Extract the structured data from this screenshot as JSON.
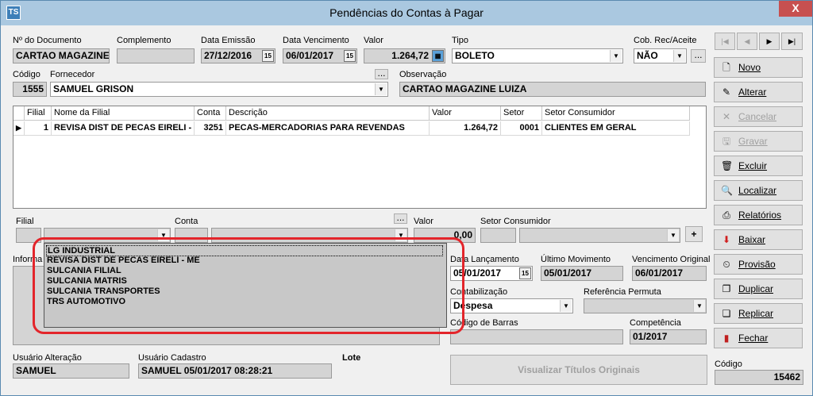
{
  "window": {
    "title": "Pendências do Contas à Pagar",
    "app_icon": "TS",
    "close": "X"
  },
  "fields": {
    "doc_label": "Nº do Documento",
    "doc_value": "CARTAO MAGAZINE",
    "complemento_label": "Complemento",
    "complemento_value": "",
    "emissao_label": "Data Emissão",
    "emissao_value": "27/12/2016",
    "vencimento_label": "Data Vencimento",
    "vencimento_value": "06/01/2017",
    "valor_label": "Valor",
    "valor_value": "1.264,72",
    "tipo_label": "Tipo",
    "tipo_value": "BOLETO",
    "cob_label": "Cob. Rec/Aceite",
    "cob_value": "NÃO",
    "codigo_label": "Código",
    "codigo_value": "1555",
    "fornecedor_label": "Fornecedor",
    "fornecedor_value": "SAMUEL GRISON",
    "observacao_label": "Observação",
    "observacao_value": "CARTAO MAGAZINE LUIZA",
    "ellipsis": "..."
  },
  "grid": {
    "headers": [
      "Filial",
      "Nome da Filial",
      "Conta",
      "Descrição",
      "Valor",
      "Setor",
      "Setor Consumidor"
    ],
    "rows": [
      [
        "1",
        "REVISA DIST DE PECAS EIRELI - M",
        "3251",
        "PECAS-MERCADORIAS PARA REVENDAS",
        "1.264,72",
        "0001",
        "CLIENTES EM GERAL"
      ]
    ]
  },
  "entry": {
    "filial_label": "Filial",
    "conta_label": "Conta",
    "valor_label": "Valor",
    "valor_value": "0,00",
    "setor_label": "Setor Consumidor",
    "add": "+"
  },
  "popup": {
    "items": [
      "LG INDUSTRIAL",
      "REVISA DIST DE PECAS EIRELI - ME",
      "SULCANIA FILIAL",
      "SULCANIA MATRIS",
      "SULCANIA TRANSPORTES",
      "TRS AUTOMOTIVO"
    ]
  },
  "info": {
    "label": "Informa"
  },
  "dates": {
    "lancamento_label": "Data Lançamento",
    "lancamento_value": "05/01/2017",
    "ultimo_label": "Último Movimento",
    "ultimo_value": "05/01/2017",
    "venc_original_label": "Vencimento Original",
    "venc_original_value": "06/01/2017",
    "contab_label": "Contabilização",
    "contab_value": "Despesa",
    "permuta_label": "Referência Permuta",
    "permuta_value": "",
    "barras_label": "Código de Barras",
    "barras_value": "",
    "competencia_label": "Competência",
    "competencia_value": "01/2017"
  },
  "footer": {
    "usuario_alt_label": "Usuário Alteração",
    "usuario_alt_value": "SAMUEL",
    "usuario_cad_label": "Usuário Cadastro",
    "usuario_cad_value": "SAMUEL 05/01/2017 08:28:21",
    "lote_label": "Lote",
    "visualizar": "Visualizar Títulos Originais",
    "codigo_label": "Código",
    "codigo_value": "15462"
  },
  "nav": {
    "first": "|◀",
    "prev": "◀",
    "next": "▶",
    "last": "▶|"
  },
  "sidebar": [
    {
      "label": "Novo",
      "icon": "new-doc-icon",
      "glyph": "🗋",
      "enabled": true
    },
    {
      "label": "Alterar",
      "icon": "edit-icon",
      "glyph": "✎",
      "enabled": true
    },
    {
      "label": "Cancelar",
      "icon": "cancel-icon",
      "glyph": "✕",
      "enabled": false
    },
    {
      "label": "Gravar",
      "icon": "save-icon",
      "glyph": "🖫",
      "enabled": false
    },
    {
      "label": "Excluir",
      "icon": "trash-icon",
      "glyph": "🗑",
      "enabled": true
    },
    {
      "label": "Localizar",
      "icon": "magnifier-icon",
      "glyph": "🔍",
      "enabled": true
    },
    {
      "label": "Relatórios",
      "icon": "printer-icon",
      "glyph": "⎙",
      "enabled": true
    },
    {
      "label": "Baixar",
      "icon": "down-arrow-icon",
      "glyph": "⬇",
      "enabled": true
    },
    {
      "label": "Provisão",
      "icon": "clock-icon",
      "glyph": "⏲",
      "enabled": true
    },
    {
      "label": "Duplicar",
      "icon": "duplicate-icon",
      "glyph": "❐",
      "enabled": true
    },
    {
      "label": "Replicar",
      "icon": "replicate-icon",
      "glyph": "❏",
      "enabled": true
    },
    {
      "label": "Fechar",
      "icon": "exit-door-icon",
      "glyph": "▮",
      "enabled": true
    }
  ]
}
